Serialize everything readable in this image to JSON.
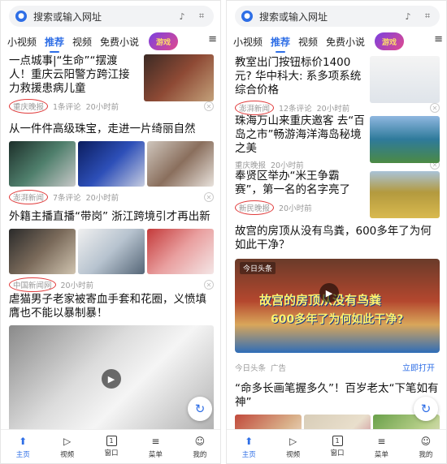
{
  "search": {
    "placeholder": "搜索或输入网址"
  },
  "tabs": [
    "小视频",
    "推荐",
    "视频",
    "免费小说"
  ],
  "promo_label": "游戏",
  "left": {
    "items": [
      {
        "title": "一点城事|“生命”“摆渡人！重庆云阳警方跨江接力救援患病儿童",
        "source": "重庆晚报",
        "comments": "1条评论",
        "time": "20小时前"
      },
      {
        "title": "从一件件高级珠宝，走进一片绮丽自然",
        "source": "澎湃新闻",
        "comments": "7条评论",
        "time": "20小时前"
      },
      {
        "title": "外籍主播直播“带岗” 浙江跨境引才再出新",
        "source": "中国新闻网",
        "comments": "",
        "time": "20小时前"
      },
      {
        "title": "虐猫男子老家被寄血手套和花圈，义愤填膺也不能以暴制暴！",
        "source": "",
        "comments": "",
        "time": ""
      }
    ]
  },
  "right": {
    "items": [
      {
        "title": "教室出门按钮标价1400元? 华中科大: 系多项系统综合价格",
        "source": "澎湃新闻",
        "comments": "12条评论",
        "time": "20小时前"
      },
      {
        "title": "珠海万山来重庆邀客 去“百岛之市”畅游海洋海岛秘境之美",
        "source": "重庆晚报",
        "comments": "",
        "time": "20小时前"
      },
      {
        "title": "奉贤区举办“米王争霸赛”，第一名的名字亮了",
        "source": "新民晚报",
        "comments": "",
        "time": "20小时前"
      },
      {
        "title": "故宫的房顶从没有鸟粪，600多年了为何如此干净？",
        "source": "今日头条",
        "ad": "广告",
        "cta": "立即打开"
      },
      {
        "title": "“命多长画笔握多久”！百岁老太“下笔如有神”",
        "source": "",
        "comments": "",
        "time": ""
      }
    ],
    "ad_brand": "今日头条",
    "ad_caption_1": "故宫的房顶从没有鸟粪",
    "ad_caption_2": "600多年了为何如此干净?"
  },
  "nav": [
    "主页",
    "视频",
    "窗口",
    "菜单",
    "我的"
  ],
  "nav_window_count": "1",
  "colors": {
    "accent": "#2e6ee6",
    "highlight": "#e03c3c"
  }
}
